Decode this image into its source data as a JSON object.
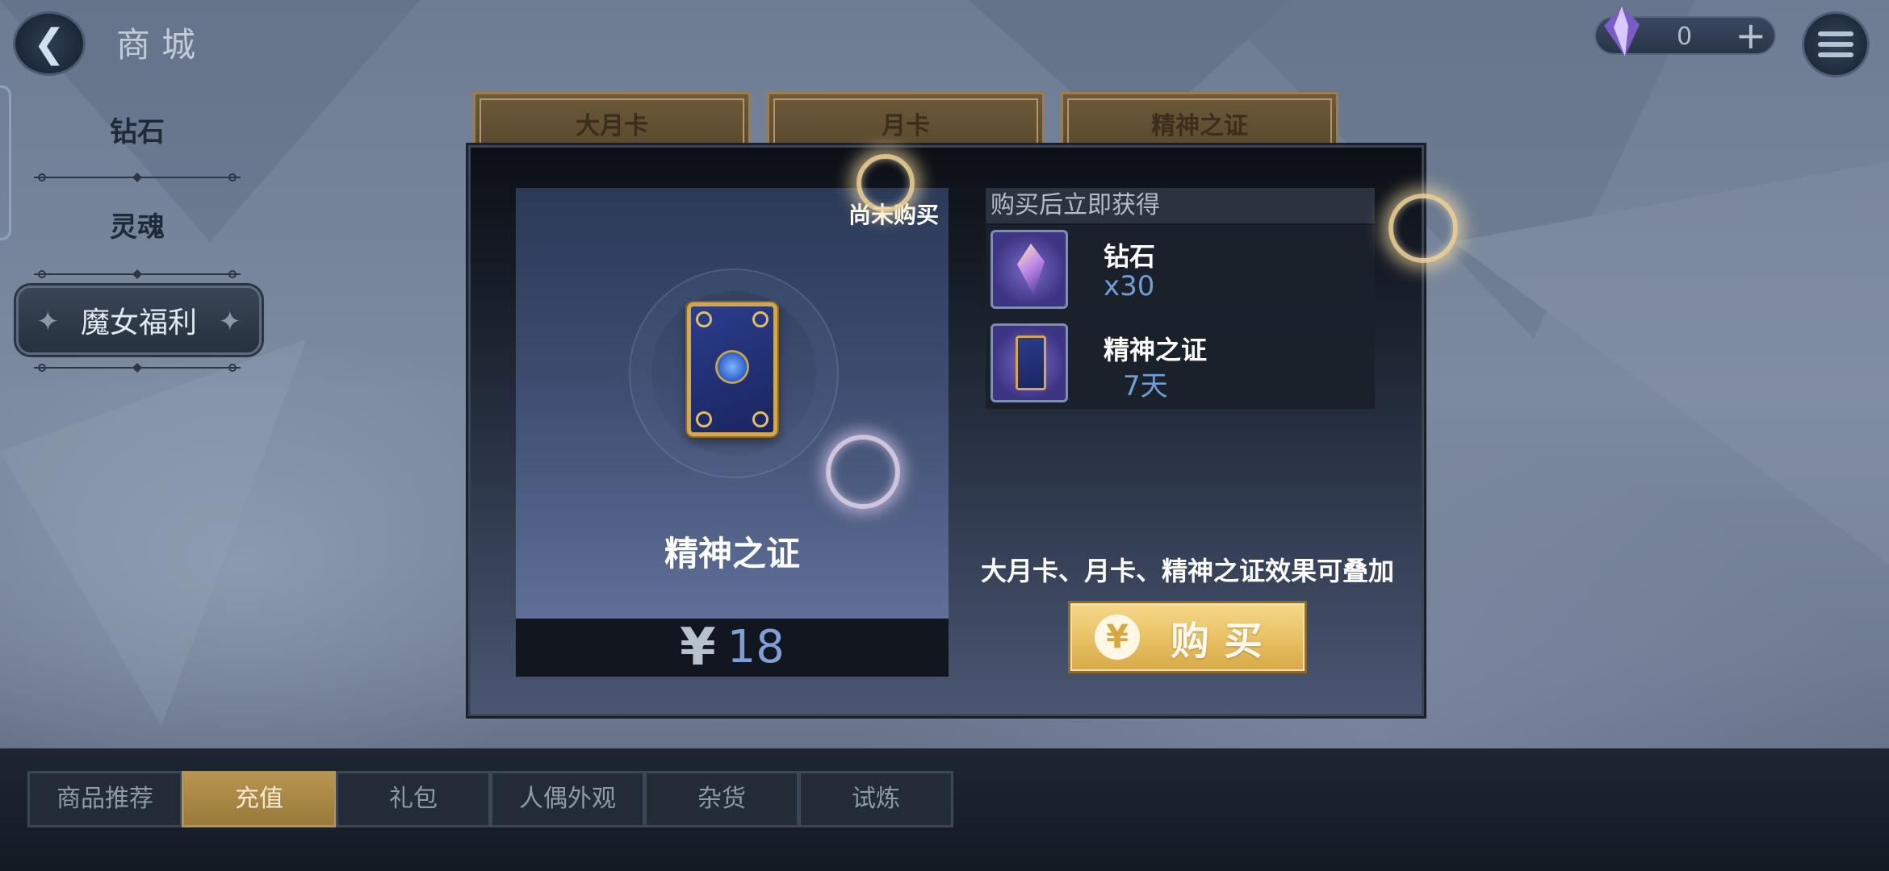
{
  "header": {
    "title": "商城",
    "back_icon": "back-arrow-icon",
    "currency": {
      "icon": "diamond-icon",
      "value": "0",
      "add_icon": "plus-icon"
    },
    "menu_icon": "hamburger-menu-icon"
  },
  "sidebar": {
    "items": [
      {
        "label": "钻石"
      },
      {
        "label": "灵魂"
      },
      {
        "label": "魔女福利"
      }
    ]
  },
  "card_tabs": [
    {
      "label": "大月卡"
    },
    {
      "label": "月卡"
    },
    {
      "label": "精神之证"
    }
  ],
  "modal": {
    "status": "尚未购买",
    "product_name": "精神之证",
    "price_symbol": "¥",
    "price": "18",
    "rewards_header": "购买后立即获得",
    "rewards": [
      {
        "name": "钻石",
        "amount": "x30",
        "icon": "diamond-icon"
      },
      {
        "name": "精神之证",
        "amount": "7天",
        "icon": "spirit-card-icon"
      }
    ],
    "stack_note": "大月卡、月卡、精神之证效果可叠加",
    "buy_button": {
      "coin": "¥",
      "label": "购买"
    }
  },
  "bottom_tabs": [
    {
      "label": "商品推荐",
      "active": false
    },
    {
      "label": "充值",
      "active": true
    },
    {
      "label": "礼包",
      "active": false
    },
    {
      "label": "人偶外观",
      "active": false
    },
    {
      "label": "杂货",
      "active": false
    },
    {
      "label": "试炼",
      "active": false
    }
  ],
  "colors": {
    "accent_gold": "#e6bd5e",
    "price_blue": "#7fa0d6",
    "reward_amount_blue": "#6e9ed6"
  }
}
